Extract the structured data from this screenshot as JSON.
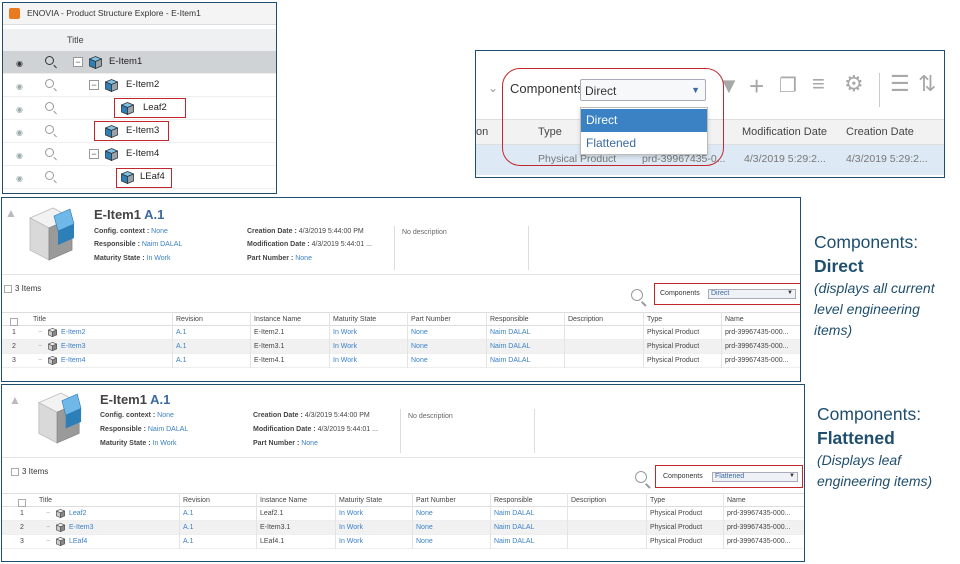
{
  "tree_panel": {
    "window_title": "ENOVIA - Product Structure Explore - E-Item1",
    "column_title": "Title",
    "rows": [
      {
        "label": "E-Item1"
      },
      {
        "label": "E-Item2"
      },
      {
        "label": "Leaf2"
      },
      {
        "label": "E-Item3"
      },
      {
        "label": "E-Item4"
      },
      {
        "label": "LEaf4"
      }
    ]
  },
  "filter_panel": {
    "components_label": "Components:",
    "selected": "Direct",
    "options": [
      "Direct",
      "Flattened"
    ],
    "columns": [
      "on",
      "Type",
      "Modification Date",
      "Creation Date"
    ],
    "row": {
      "type": "Physical Product",
      "name": "prd-39967435-0...",
      "modification_date": "4/3/2019 5:29:2...",
      "creation_date": "4/3/2019 5:29:2..."
    }
  },
  "panel_direct": {
    "title": "E-Item1",
    "revision": "A.1",
    "config_context_label": "Config. context : ",
    "config_context": "None",
    "responsible_label": "Responsible : ",
    "responsible": "Naim DALAL",
    "maturity_label": "Maturity State : ",
    "maturity": "In Work",
    "creation_label": "Creation Date : ",
    "creation": "4/3/2019 5:44:00 PM",
    "modification_label": "Modification Date : ",
    "modification": "4/3/2019 5:44:01 ...",
    "part_number_label": "Part Number : ",
    "part_number": "None",
    "description": "No description",
    "items_count": "3 Items",
    "components_label": "Components",
    "components_value": "Direct",
    "columns": [
      "Title",
      "Revision",
      "Instance Name",
      "Maturity State",
      "Part Number",
      "Responsible",
      "Description",
      "Type",
      "Name"
    ],
    "rows": [
      {
        "n": "1",
        "title": "E-Item2",
        "rev": "A.1",
        "inst": "E-Item2.1",
        "state": "In Work",
        "pn": "None",
        "resp": "Naim DALAL",
        "type": "Physical Product",
        "name": "prd-39967435-000..."
      },
      {
        "n": "2",
        "title": "E-Item3",
        "rev": "A.1",
        "inst": "E-Item3.1",
        "state": "In Work",
        "pn": "None",
        "resp": "Naim DALAL",
        "type": "Physical Product",
        "name": "prd-39967435-000..."
      },
      {
        "n": "3",
        "title": "E-Item4",
        "rev": "A.1",
        "inst": "E-Item4.1",
        "state": "In Work",
        "pn": "None",
        "resp": "Naim DALAL",
        "type": "Physical Product",
        "name": "prd-39967435-000..."
      }
    ]
  },
  "panel_flat": {
    "title": "E-Item1",
    "revision": "A.1",
    "config_context_label": "Config. context : ",
    "config_context": "None",
    "responsible_label": "Responsible : ",
    "responsible": "Naim DALAL",
    "maturity_label": "Maturity State : ",
    "maturity": "In Work",
    "creation_label": "Creation Date : ",
    "creation": "4/3/2019 5:44:00 PM",
    "modification_label": "Modification Date : ",
    "modification": "4/3/2019 5:44:01 ...",
    "part_number_label": "Part Number : ",
    "part_number": "None",
    "description": "No description",
    "items_count": "3 Items",
    "components_label": "Components",
    "components_value": "Flattened",
    "columns": [
      "Title",
      "Revision",
      "Instance Name",
      "Maturity State",
      "Part Number",
      "Responsible",
      "Description",
      "Type",
      "Name"
    ],
    "rows": [
      {
        "n": "1",
        "title": "Leaf2",
        "rev": "A.1",
        "inst": "Leaf2.1",
        "state": "In Work",
        "pn": "None",
        "resp": "Naim DALAL",
        "type": "Physical Product",
        "name": "prd-39967435-000..."
      },
      {
        "n": "2",
        "title": "E-Item3",
        "rev": "A.1",
        "inst": "E-Item3.1",
        "state": "In Work",
        "pn": "None",
        "resp": "Naim DALAL",
        "type": "Physical Product",
        "name": "prd-39967435-000..."
      },
      {
        "n": "3",
        "title": "LEaf4",
        "rev": "A.1",
        "inst": "LEaf4.1",
        "state": "In Work",
        "pn": "None",
        "resp": "Naim DALAL",
        "type": "Physical Product",
        "name": "prd-39967435-000..."
      }
    ]
  },
  "annotations": {
    "direct": {
      "heading": "Components:",
      "mode": "Direct",
      "note": "(displays all current level engineering items)"
    },
    "flat": {
      "heading": "Components:",
      "mode": "Flattened",
      "note": "(Displays leaf engineering items)"
    }
  },
  "colors": {
    "frame": "#1f4e6e",
    "highlight": "#c0282d",
    "link": "#3b80c8",
    "accent": "#3b82c4"
  }
}
